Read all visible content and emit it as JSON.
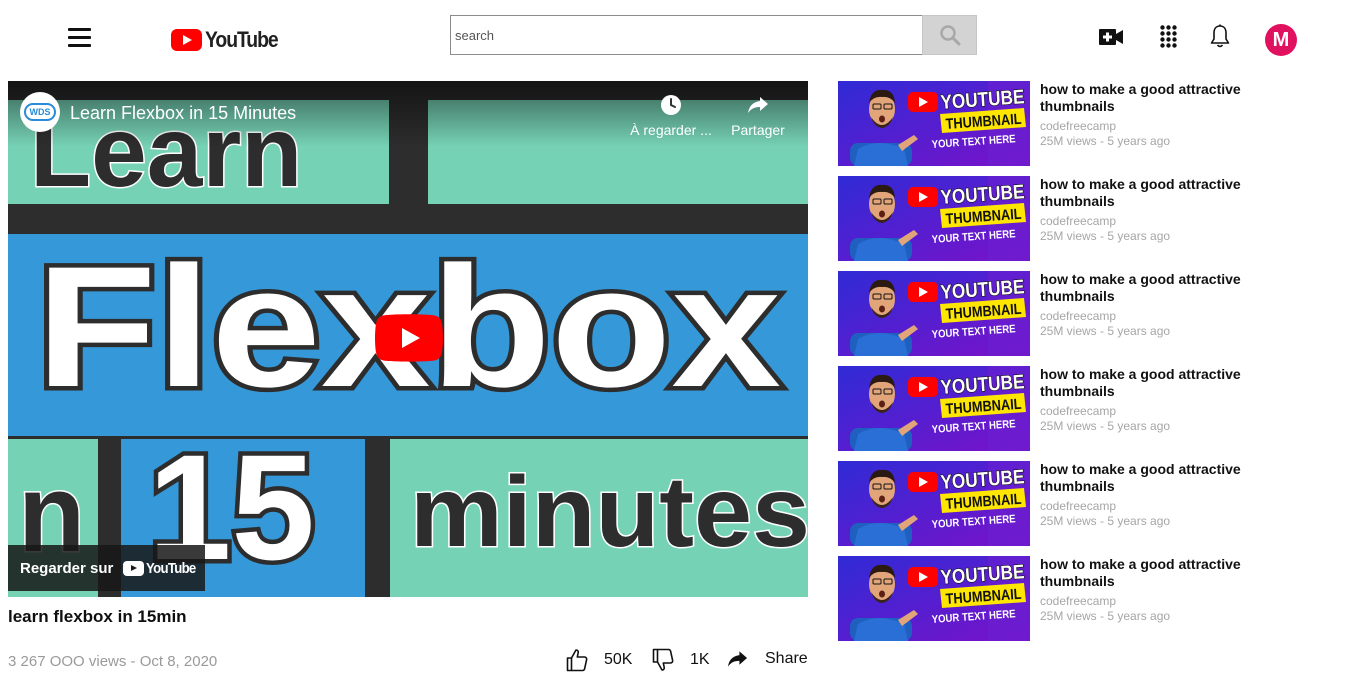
{
  "header": {
    "logo_text": "YouTube",
    "search_placeholder": "search",
    "avatar_initial": "M",
    "avatar_color": "#e0115f"
  },
  "player": {
    "title": "Learn Flexbox in 15 Minutes",
    "channel_badge": "WDS",
    "watch_later_label": "À regarder ...",
    "share_label": "Partager",
    "watch_on_label": "Regarder sur",
    "watch_on_brand": "YouTube",
    "thumb_lines": [
      "Learn",
      "Flexbox",
      "n",
      "15",
      "minutes"
    ]
  },
  "video": {
    "title": "learn flexbox in 15min",
    "meta": "3 267 OOO views - Oct 8, 2020",
    "likes": "50K",
    "dislikes": "1K",
    "share": "Share"
  },
  "recommendations": [
    {
      "title": "how to make a good attractive thumbnails",
      "channel": "codefreecamp",
      "stats": "25M views - 5 years ago"
    },
    {
      "title": "how to make a good attractive thumbnails",
      "channel": "codefreecamp",
      "stats": "25M views - 5 years ago"
    },
    {
      "title": "how to make a good attractive thumbnails",
      "channel": "codefreecamp",
      "stats": "25M views - 5 years ago"
    },
    {
      "title": "how to make a good attractive thumbnails",
      "channel": "codefreecamp",
      "stats": "25M views - 5 years ago"
    },
    {
      "title": "how to make a good attractive thumbnails",
      "channel": "codefreecamp",
      "stats": "25M views - 5 years ago"
    },
    {
      "title": "how to make a good attractive thumbnails",
      "channel": "codefreecamp",
      "stats": "25M views - 5 years ago"
    }
  ],
  "rec_thumb": {
    "line1": "YOUTUBE",
    "line2": "THUMBNAIL",
    "line3": "YOUR TEXT HERE"
  },
  "icons": [
    "menu-icon",
    "youtube-logo-icon",
    "search-icon",
    "create-video-icon",
    "apps-grid-icon",
    "bell-icon",
    "clock-icon",
    "share-arrow-icon",
    "play-icon",
    "thumbs-up-icon",
    "thumbs-down-icon"
  ]
}
